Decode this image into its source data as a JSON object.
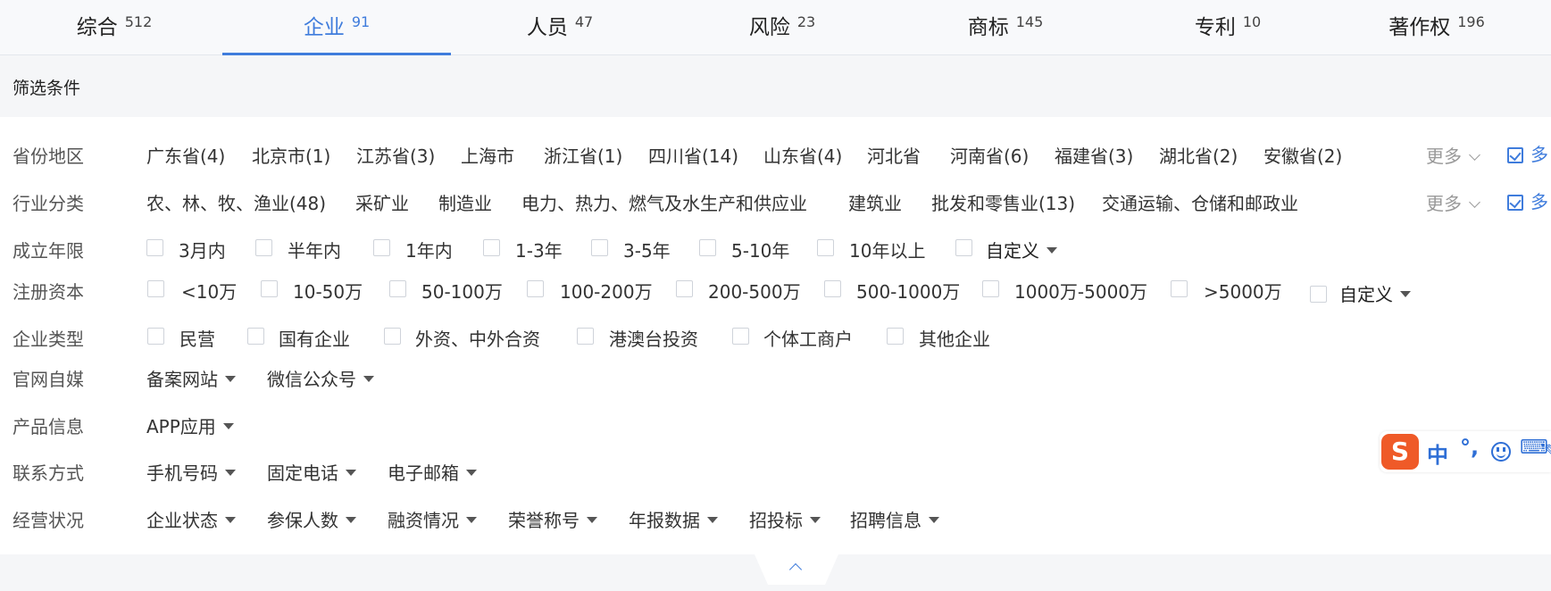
{
  "tabs": [
    {
      "label": "综合",
      "count": "512"
    },
    {
      "label": "企业",
      "count": "91"
    },
    {
      "label": "人员",
      "count": "47"
    },
    {
      "label": "风险",
      "count": "23"
    },
    {
      "label": "商标",
      "count": "145"
    },
    {
      "label": "专利",
      "count": "10"
    },
    {
      "label": "著作权",
      "count": "196"
    }
  ],
  "active_tab": "企业",
  "filter_title": "筛选条件",
  "more_label": "更多",
  "multi_label": "多",
  "province": {
    "label": "省份地区",
    "options": [
      "广东省(4)",
      "北京市(1)",
      "江苏省(3)",
      "上海市",
      "浙江省(1)",
      "四川省(14)",
      "山东省(4)",
      "河北省",
      "河南省(6)",
      "福建省(3)",
      "湖北省(2)",
      "安徽省(2)"
    ]
  },
  "industry": {
    "label": "行业分类",
    "options": [
      "农、林、牧、渔业(48)",
      "采矿业",
      "制造业",
      "电力、热力、燃气及水生产和供应业",
      "建筑业",
      "批发和零售业(13)",
      "交通运输、仓储和邮政业"
    ]
  },
  "established": {
    "label": "成立年限",
    "options": [
      "3月内",
      "半年内",
      "1年内",
      "1-3年",
      "3-5年",
      "5-10年",
      "10年以上"
    ],
    "custom": "自定义"
  },
  "capital": {
    "label": "注册资本",
    "options": [
      "<10万",
      "10-50万",
      "50-100万",
      "100-200万",
      "200-500万",
      "500-1000万",
      "1000万-5000万",
      ">5000万"
    ],
    "custom": "自定义"
  },
  "company_type": {
    "label": "企业类型",
    "options": [
      "民营",
      "国有企业",
      "外资、中外合资",
      "港澳台投资",
      "个体工商户",
      "其他企业"
    ]
  },
  "website_media": {
    "label": "官网自媒",
    "dropdowns": [
      "备案网站",
      "微信公众号"
    ]
  },
  "product_info": {
    "label": "产品信息",
    "dropdowns": [
      "APP应用"
    ]
  },
  "contact": {
    "label": "联系方式",
    "dropdowns": [
      "手机号码",
      "固定电话",
      "电子邮箱"
    ]
  },
  "operation": {
    "label": "经营状况",
    "dropdowns": [
      "企业状态",
      "参保人数",
      "融资情况",
      "荣誉称号",
      "年报数据",
      "招投标",
      "招聘信息"
    ]
  },
  "ime": {
    "logo": "S",
    "mode": "中",
    "punct": "°,"
  },
  "colors": {
    "accent": "#3f7cdc",
    "ime_logo": "#ef5a28"
  }
}
